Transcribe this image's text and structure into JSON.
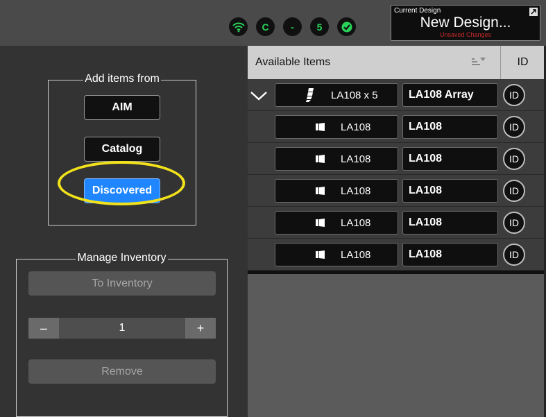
{
  "status": {
    "icons": [
      {
        "name": "wifi-icon",
        "label": ""
      },
      {
        "name": "c-status-icon",
        "label": "C"
      },
      {
        "name": "dash-status-icon",
        "label": "-"
      },
      {
        "name": "five-status-icon",
        "label": "5"
      },
      {
        "name": "check-status-icon",
        "label": ""
      }
    ],
    "accent_color": "#29d35a"
  },
  "design": {
    "caption": "Current Design",
    "name": "New Design...",
    "unsaved": "Unsaved Changes"
  },
  "add_items": {
    "title": "Add items from",
    "aim_label": "AIM",
    "catalog_label": "Catalog",
    "discovered_label": "Discovered",
    "active_color": "#1f86ff"
  },
  "inventory": {
    "title": "Manage Inventory",
    "to_inventory_label": "To Inventory",
    "minus_label": "–",
    "plus_label": "+",
    "quantity": "1",
    "remove_label": "Remove"
  },
  "table": {
    "header_title": "Available Items",
    "header_id": "ID",
    "rows": [
      {
        "model": "LA108 x 5",
        "name": "LA108 Array",
        "id": "ID",
        "is_array": true
      },
      {
        "model": "LA108",
        "name": "LA108",
        "id": "ID",
        "is_array": false
      },
      {
        "model": "LA108",
        "name": "LA108",
        "id": "ID",
        "is_array": false
      },
      {
        "model": "LA108",
        "name": "LA108",
        "id": "ID",
        "is_array": false
      },
      {
        "model": "LA108",
        "name": "LA108",
        "id": "ID",
        "is_array": false
      },
      {
        "model": "LA108",
        "name": "LA108",
        "id": "ID",
        "is_array": false
      }
    ]
  }
}
